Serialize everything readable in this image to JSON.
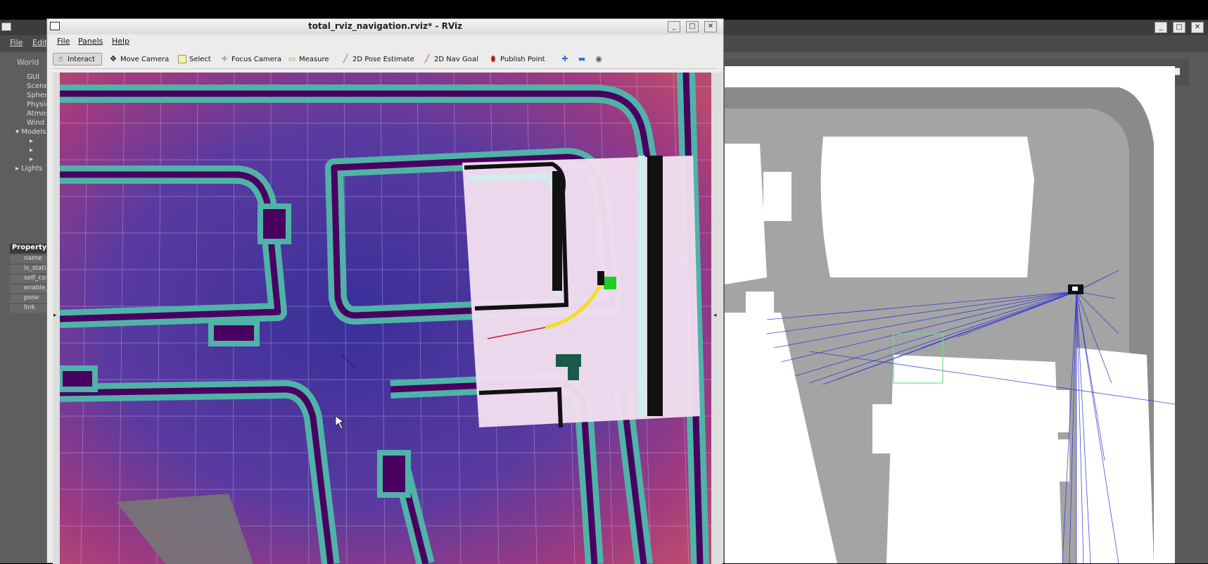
{
  "gazebo": {
    "menu": [
      "File",
      "Edit"
    ],
    "tree": {
      "world": "World",
      "items": [
        "GUI",
        "Scene",
        "Spherical",
        "Physics",
        "Atmosphere",
        "Wind"
      ],
      "models_label": "Models",
      "lights_label": "Lights"
    },
    "properties": {
      "header": "Property",
      "rows": [
        "name",
        "is_static",
        "self_collide",
        "enable_wind",
        "pose",
        "link"
      ]
    }
  },
  "rviz": {
    "title": "total_rviz_navigation.rviz* - RViz",
    "menu": {
      "file": "File",
      "panels": "Panels",
      "help": "Help"
    },
    "tools": [
      {
        "label": "Interact",
        "icon": "hand-icon"
      },
      {
        "label": "Move Camera",
        "icon": "move-camera-icon"
      },
      {
        "label": "Select",
        "icon": "select-icon"
      },
      {
        "label": "Focus Camera",
        "icon": "focus-camera-icon"
      },
      {
        "label": "Measure",
        "icon": "measure-icon"
      },
      {
        "label": "2D Pose Estimate",
        "icon": "pose-estimate-icon"
      },
      {
        "label": "2D Nav Goal",
        "icon": "nav-goal-icon"
      },
      {
        "label": "Publish Point",
        "icon": "publish-point-icon"
      }
    ],
    "active_tool": "Interact"
  },
  "colors": {
    "costmap_bg": "#3b2f8a",
    "inflation": "#4fb3a8",
    "obstacle": "#4a0060",
    "laser": "#2a2ad8",
    "path_global": "#f0e020",
    "path_local": "#c0202a"
  }
}
